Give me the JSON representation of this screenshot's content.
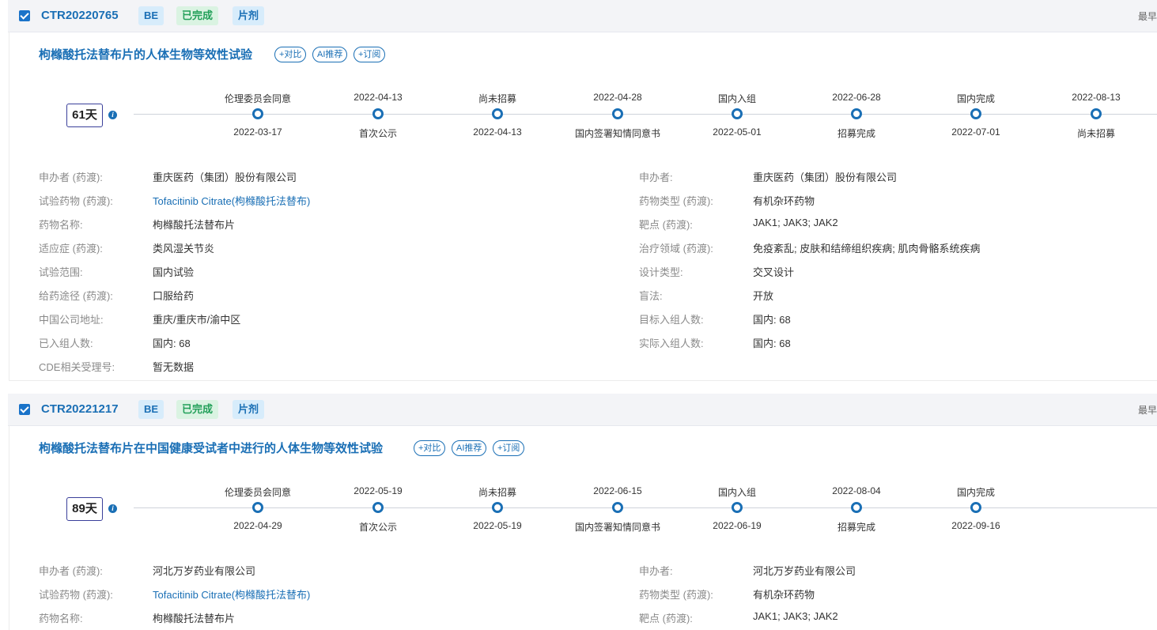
{
  "trials": [
    {
      "id": "CTR20220765",
      "tags": [
        "BE",
        "已完成",
        "片剂"
      ],
      "header_right": "最早",
      "title": "枸橼酸托法替布片的人体生物等效性试验",
      "actions": [
        "+对比",
        "AI推荐",
        "+订阅"
      ],
      "days": "61天",
      "timeline": [
        {
          "top": "伦理委员会同意",
          "bottom": "2022-03-17"
        },
        {
          "top": "2022-04-13",
          "bottom": "首次公示"
        },
        {
          "top": "尚未招募",
          "bottom": "2022-04-13"
        },
        {
          "top": "2022-04-28",
          "bottom": "国内签署知情同意书"
        },
        {
          "top": "国内入组",
          "bottom": "2022-05-01"
        },
        {
          "top": "2022-06-28",
          "bottom": "招募完成"
        },
        {
          "top": "国内完成",
          "bottom": "2022-07-01"
        },
        {
          "top": "2022-08-13",
          "bottom": "尚未招募"
        }
      ],
      "left_fields": [
        {
          "label": "申办者 (药渡):",
          "value": "重庆医药（集团）股份有限公司"
        },
        {
          "label": "试验药物 (药渡):",
          "value": "Tofacitinib Citrate(枸橼酸托法替布)"
        },
        {
          "label": "药物名称:",
          "value": "枸橼酸托法替布片"
        },
        {
          "label": "适应症 (药渡):",
          "value": "类风湿关节炎"
        },
        {
          "label": "试验范围:",
          "value": "国内试验"
        },
        {
          "label": "给药途径 (药渡):",
          "value": "口服给药"
        },
        {
          "label": "中国公司地址:",
          "value": "重庆/重庆市/渝中区"
        },
        {
          "label": "已入组人数:",
          "value": "国内: 68"
        },
        {
          "label": "CDE相关受理号:",
          "value": "暂无数据"
        }
      ],
      "right_fields": [
        {
          "label": "申办者:",
          "value": "重庆医药（集团）股份有限公司"
        },
        {
          "label": "药物类型 (药渡):",
          "value": "有机杂环药物"
        },
        {
          "label": "靶点 (药渡):",
          "value": "JAK1; JAK3; JAK2"
        },
        {
          "label": "治疗领域 (药渡):",
          "value": "免疫紊乱; 皮肤和结缔组织疾病; 肌肉骨骼系统疾病"
        },
        {
          "label": "设计类型:",
          "value": "交叉设计"
        },
        {
          "label": "盲法:",
          "value": "开放"
        },
        {
          "label": "目标入组人数:",
          "value": "国内: 68"
        },
        {
          "label": "实际入组人数:",
          "value": "国内: 68"
        }
      ]
    },
    {
      "id": "CTR20221217",
      "tags": [
        "BE",
        "已完成",
        "片剂"
      ],
      "header_right": "最早",
      "title": "枸橼酸托法替布片在中国健康受试者中进行的人体生物等效性试验",
      "actions": [
        "+对比",
        "AI推荐",
        "+订阅"
      ],
      "days": "89天",
      "timeline": [
        {
          "top": "伦理委员会同意",
          "bottom": "2022-04-29"
        },
        {
          "top": "2022-05-19",
          "bottom": "首次公示"
        },
        {
          "top": "尚未招募",
          "bottom": "2022-05-19"
        },
        {
          "top": "2022-06-15",
          "bottom": "国内签署知情同意书"
        },
        {
          "top": "国内入组",
          "bottom": "2022-06-19"
        },
        {
          "top": "2022-08-04",
          "bottom": "招募完成"
        },
        {
          "top": "国内完成",
          "bottom": "2022-09-16"
        }
      ],
      "left_fields": [
        {
          "label": "申办者 (药渡):",
          "value": "河北万岁药业有限公司"
        },
        {
          "label": "试验药物 (药渡):",
          "value": "Tofacitinib Citrate(枸橼酸托法替布)"
        },
        {
          "label": "药物名称:",
          "value": "枸橼酸托法替布片"
        }
      ],
      "right_fields": [
        {
          "label": "申办者:",
          "value": "河北万岁药业有限公司"
        },
        {
          "label": "药物类型 (药渡):",
          "value": "有机杂环药物"
        },
        {
          "label": "靶点 (药渡):",
          "value": "JAK1; JAK3; JAK2"
        }
      ]
    }
  ]
}
